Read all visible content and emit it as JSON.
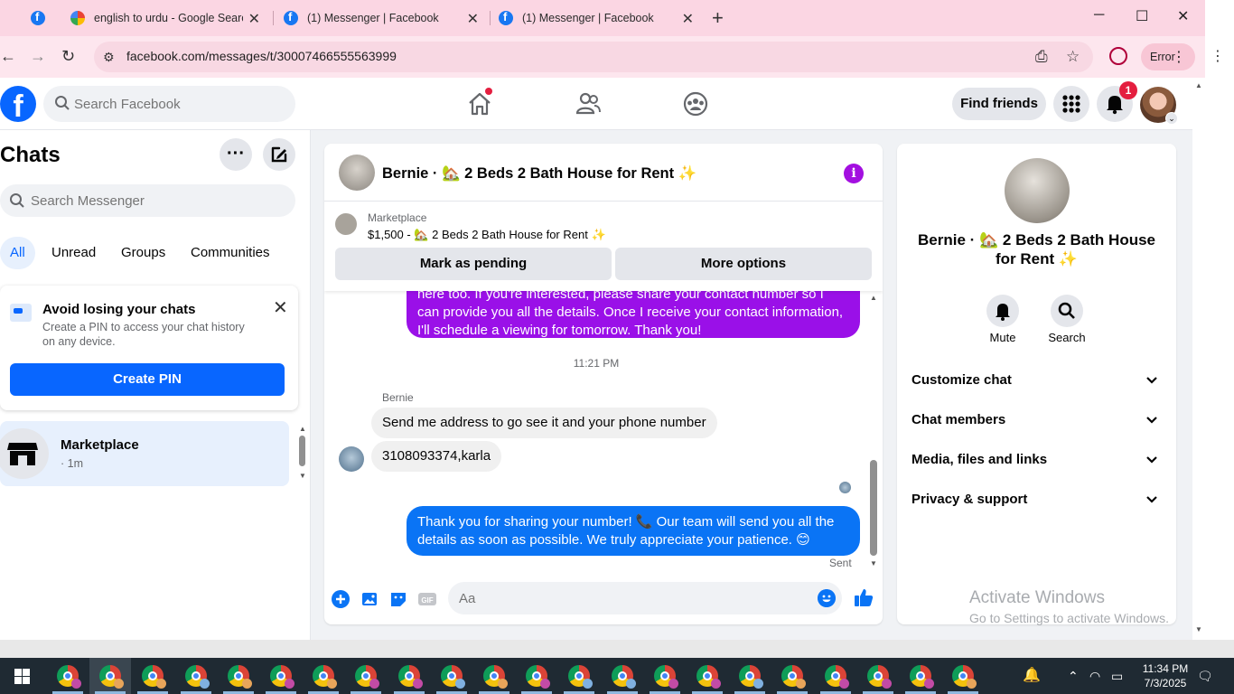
{
  "browser": {
    "tabs": [
      {
        "title": "english to urdu - Google Search",
        "icon": "google-icon"
      },
      {
        "title": "(1) Messenger | Facebook",
        "icon": "facebook-icon"
      },
      {
        "title": "(1) Messenger | Facebook",
        "icon": "facebook-icon"
      }
    ],
    "new_tab": "+",
    "url": "facebook.com/messages/t/30007466555563999",
    "profile_status": "Error"
  },
  "fb_header": {
    "search_placeholder": "Search Facebook",
    "find_friends": "Find friends",
    "notification_count": "1"
  },
  "left": {
    "title": "Chats",
    "search_placeholder": "Search Messenger",
    "filters": [
      "All",
      "Unread",
      "Groups",
      "Communities"
    ],
    "pin_card": {
      "title": "Avoid losing your chats",
      "description": "Create a PIN to access your chat history on any device.",
      "button": "Create PIN"
    },
    "chat_list": [
      {
        "name": "Marketplace",
        "time": "· 1m"
      }
    ]
  },
  "conversation": {
    "header_title": "Bernie · 🏡 2 Beds 2 Bath House for Rent ✨",
    "banner": {
      "label": "Marketplace",
      "price_line": "$1,500 - 🏡 2 Beds 2 Bath House for Rent ✨",
      "mark_pending": "Mark as pending",
      "more_options": "More options"
    },
    "outgoing_partial": "here too. If you're interested, please share your contact number so I can provide you  all the details. Once I receive your contact information, I'll schedule a viewing for tomorrow. Thank you!",
    "timestamp": "11:21 PM",
    "sender_name": "Bernie",
    "incoming": [
      "Send me address to go see it and your phone number",
      "3108093374,karla"
    ],
    "outgoing_last": "Thank you for sharing your number! 📞 Our team will send you all the details as soon as possible. We truly appreciate your patience. 😊",
    "sent_status": "Sent",
    "composer_placeholder": "Aa"
  },
  "right": {
    "name": "Bernie · 🏡 2 Beds 2 Bath House for Rent ✨",
    "actions": [
      "Mute",
      "Search"
    ],
    "sections": [
      "Customize chat",
      "Chat members",
      "Media, files and links",
      "Privacy & support"
    ]
  },
  "watermark": {
    "line1": "Activate Windows",
    "line2": "Go to Settings to activate Windows."
  },
  "taskbar": {
    "time": "11:34 PM",
    "date": "7/3/2025"
  },
  "colors": {
    "tabbar": "#fbd6e3",
    "fb_blue": "#0866ff",
    "outgoing_purple": "#9a10e8",
    "outgoing_blue": "#0a74f5",
    "taskbar": "#1f2a33"
  }
}
